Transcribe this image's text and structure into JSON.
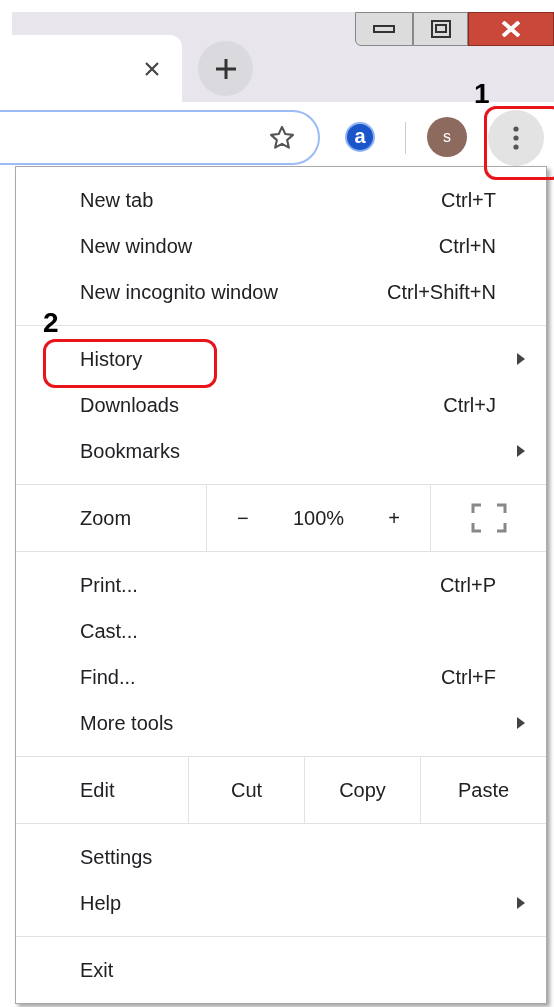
{
  "toolbar": {
    "extension_letter": "a",
    "avatar_letter": "s",
    "menu_button": {
      "annotation": "1"
    }
  },
  "menu": {
    "sections": [
      {
        "items": [
          {
            "kind": "item",
            "label": "New tab",
            "shortcut": "Ctrl+T",
            "has_submenu": false
          },
          {
            "kind": "item",
            "label": "New window",
            "shortcut": "Ctrl+N",
            "has_submenu": false
          },
          {
            "kind": "item",
            "label": "New incognito window",
            "shortcut": "Ctrl+Shift+N",
            "has_submenu": false
          }
        ]
      },
      {
        "items": [
          {
            "kind": "item",
            "label": "History",
            "has_submenu": true,
            "annotation": "2"
          },
          {
            "kind": "item",
            "label": "Downloads",
            "shortcut": "Ctrl+J",
            "has_submenu": false
          },
          {
            "kind": "item",
            "label": "Bookmarks",
            "has_submenu": true
          }
        ]
      },
      {
        "items": [
          {
            "kind": "zoom",
            "label": "Zoom",
            "minus": "−",
            "value": "100%",
            "plus": "+"
          }
        ]
      },
      {
        "items": [
          {
            "kind": "item",
            "label": "Print...",
            "shortcut": "Ctrl+P",
            "has_submenu": false
          },
          {
            "kind": "item",
            "label": "Cast...",
            "has_submenu": false
          },
          {
            "kind": "item",
            "label": "Find...",
            "shortcut": "Ctrl+F",
            "has_submenu": false
          },
          {
            "kind": "item",
            "label": "More tools",
            "has_submenu": true
          }
        ]
      },
      {
        "items": [
          {
            "kind": "edit",
            "label": "Edit",
            "buttons": [
              "Cut",
              "Copy",
              "Paste"
            ]
          }
        ]
      },
      {
        "items": [
          {
            "kind": "item",
            "label": "Settings",
            "has_submenu": false
          },
          {
            "kind": "item",
            "label": "Help",
            "has_submenu": true
          }
        ]
      },
      {
        "items": [
          {
            "kind": "item",
            "label": "Exit",
            "has_submenu": false
          }
        ]
      }
    ]
  }
}
